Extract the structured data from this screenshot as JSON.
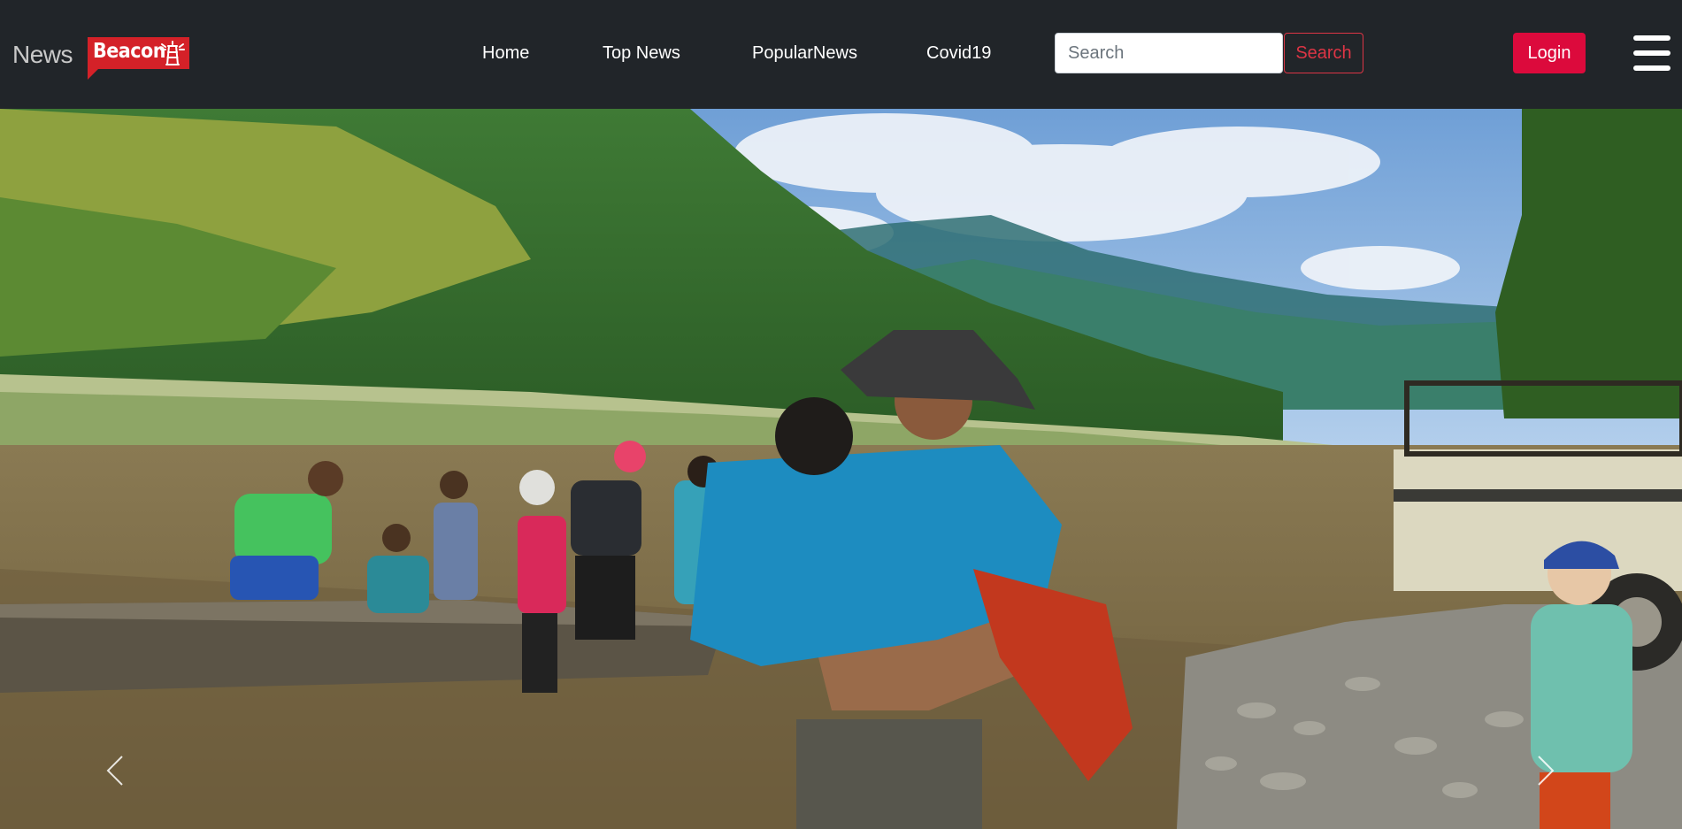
{
  "brand": {
    "name_part1": "News",
    "name_part2": "Beacon",
    "colors": {
      "navbar_bg": "#212529",
      "badge_red": "#d42128",
      "login_red": "#dc0a3c",
      "search_outline": "#dc3545"
    }
  },
  "nav": {
    "links": [
      {
        "label": "Home"
      },
      {
        "label": "Top News"
      },
      {
        "label": "PopularNews"
      },
      {
        "label": "Covid19"
      }
    ]
  },
  "search": {
    "placeholder": "Search",
    "value": "",
    "button_label": "Search"
  },
  "login": {
    "label": "Login"
  },
  "menu": {
    "icon": "hamburger-menu-icon"
  },
  "hero": {
    "icons": {
      "prev": "chevron-left-icon",
      "next": "chevron-right-icon"
    }
  }
}
